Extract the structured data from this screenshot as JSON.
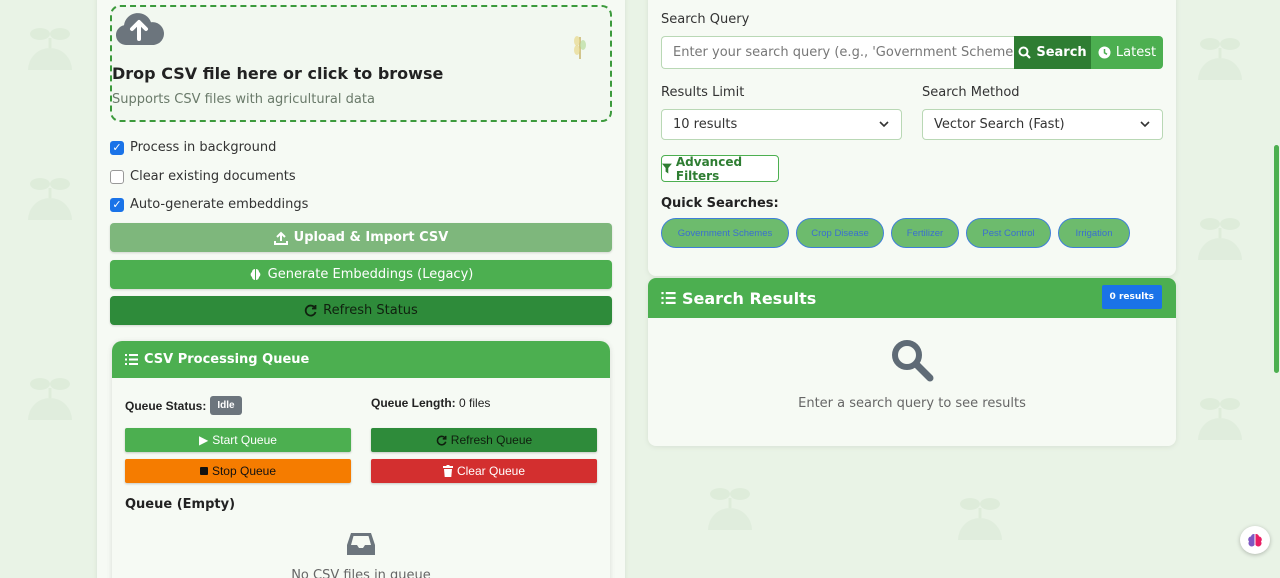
{
  "upload": {
    "dropzone_title": "Drop CSV file here or click to browse",
    "dropzone_subtitle": "Supports CSV files with agricultural data",
    "options": [
      {
        "label": "Process in background",
        "checked": true
      },
      {
        "label": "Clear existing documents",
        "checked": false
      },
      {
        "label": "Auto-generate embeddings",
        "checked": true
      }
    ],
    "upload_button": "Upload & Import CSV",
    "embed_button": "Generate Embeddings (Legacy)",
    "refresh_button": "Refresh Status"
  },
  "queue": {
    "title": "CSV Processing Queue",
    "status_label": "Queue Status:",
    "status_value": "Idle",
    "length_label": "Queue Length:",
    "length_value": "0 files",
    "start_button": "Start Queue",
    "refresh_button": "Refresh Queue",
    "stop_button": "Stop Queue",
    "clear_button": "Clear Queue",
    "list_title": "Queue (Empty)",
    "empty_text": "No CSV files in queue"
  },
  "search": {
    "query_label": "Search Query",
    "placeholder": "Enter your search query (e.g., 'Government Schemes', 'crop disease')",
    "search_button": "Search",
    "latest_button": "Latest",
    "limit_label": "Results Limit",
    "limit_value": "10 results",
    "method_label": "Search Method",
    "method_value": "Vector Search (Fast)",
    "advanced_button": "Advanced Filters",
    "quick_label": "Quick Searches:",
    "quick": [
      "Government Schemes",
      "Crop Disease",
      "Fertilizer",
      "Pest Control",
      "Irrigation"
    ]
  },
  "results": {
    "title": "Search Results",
    "count_badge": "0 results",
    "empty_text": "Enter a search query to see results"
  },
  "colors": {
    "primary": "#4caf50",
    "primary_dark": "#2e7d32",
    "badge_blue": "#1a73e8",
    "stop_orange": "#f57c00",
    "clear_red": "#d32f2f"
  }
}
